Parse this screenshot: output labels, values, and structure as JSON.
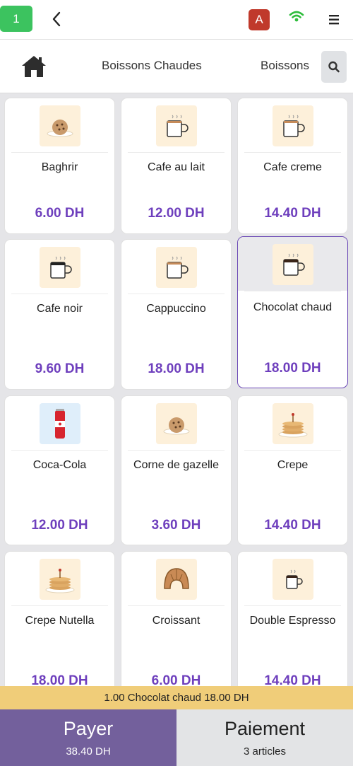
{
  "header": {
    "table_number": "1",
    "user_initial": "A"
  },
  "categories": {
    "tabs": [
      "Boissons Chaudes",
      "Boissons"
    ]
  },
  "products": [
    {
      "name": "Baghrir",
      "price": "6.00 DH",
      "icon": "cookie"
    },
    {
      "name": "Cafe au lait",
      "price": "12.00 DH",
      "icon": "coffee-cup"
    },
    {
      "name": "Cafe creme",
      "price": "14.40 DH",
      "icon": "coffee-cup"
    },
    {
      "name": "Cafe noir",
      "price": "9.60 DH",
      "icon": "coffee-cup"
    },
    {
      "name": "Cappuccino",
      "price": "18.00 DH",
      "icon": "coffee-cup"
    },
    {
      "name": "Chocolat chaud",
      "price": "18.00 DH",
      "icon": "coffee-cup",
      "selected": true
    },
    {
      "name": "Coca-Cola",
      "price": "12.00 DH",
      "icon": "cola-can"
    },
    {
      "name": "Corne de gazelle",
      "price": "3.60 DH",
      "icon": "cookie"
    },
    {
      "name": "Crepe",
      "price": "14.40 DH",
      "icon": "pancakes"
    },
    {
      "name": "Crepe Nutella",
      "price": "18.00 DH",
      "icon": "pancakes"
    },
    {
      "name": "Croissant",
      "price": "6.00 DH",
      "icon": "croissant"
    },
    {
      "name": "Double Espresso",
      "price": "14.40 DH",
      "icon": "coffee-cup-small"
    }
  ],
  "summary": {
    "text": "1.00 Chocolat chaud 18.00 DH"
  },
  "footer": {
    "pay_label": "Payer",
    "pay_total": "38.40 DH",
    "payment_label": "Paiement",
    "payment_count": "3 articles"
  },
  "colors": {
    "accent": "#6e3fbd",
    "pay_button": "#73609c",
    "summary_bar": "#f0cd79",
    "table_badge": "#3cc35f",
    "user_badge": "#c0392b"
  }
}
